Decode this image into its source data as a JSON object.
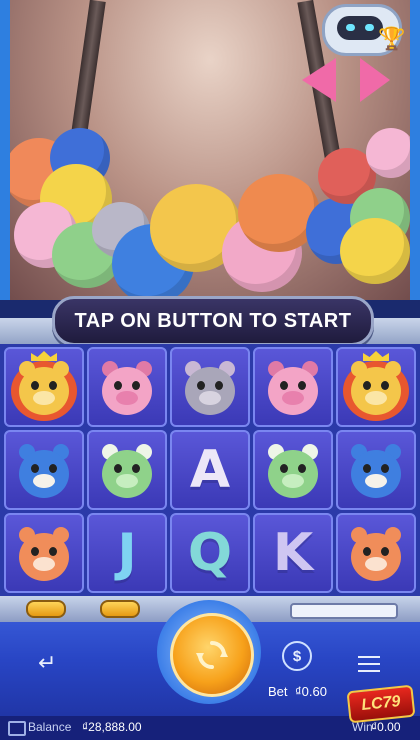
{
  "banner": {
    "text": "TAP ON BUTTON TO START"
  },
  "grid": [
    [
      "lion",
      "pig",
      "mouse",
      "pig",
      "lion"
    ],
    [
      "penguin",
      "frog",
      "A",
      "frog",
      "penguin"
    ],
    [
      "tiger",
      "J",
      "Q",
      "K",
      "tiger"
    ]
  ],
  "controls": {
    "back_icon": "undo-arrow-icon",
    "spin_icon": "spin-arrows-icon",
    "bet_icon": "coin-dollar-icon",
    "bet_icon_glyph": "$",
    "menu_icon": "hamburger-menu-icon",
    "bet_label": "Bet",
    "bet_value": "₫0.60"
  },
  "status": {
    "balance_label": "Balance",
    "balance_value": "₫28,888.00",
    "win_label": "Win",
    "win_value": "₫0.00"
  },
  "brand": {
    "logo_text": "LC79"
  },
  "colors": {
    "letter_A": "#ece7f8",
    "letter_J": "#7fd3f2",
    "letter_Q": "#83d8d8",
    "letter_K": "#cfc6f2",
    "spin": "#f7a11a"
  }
}
